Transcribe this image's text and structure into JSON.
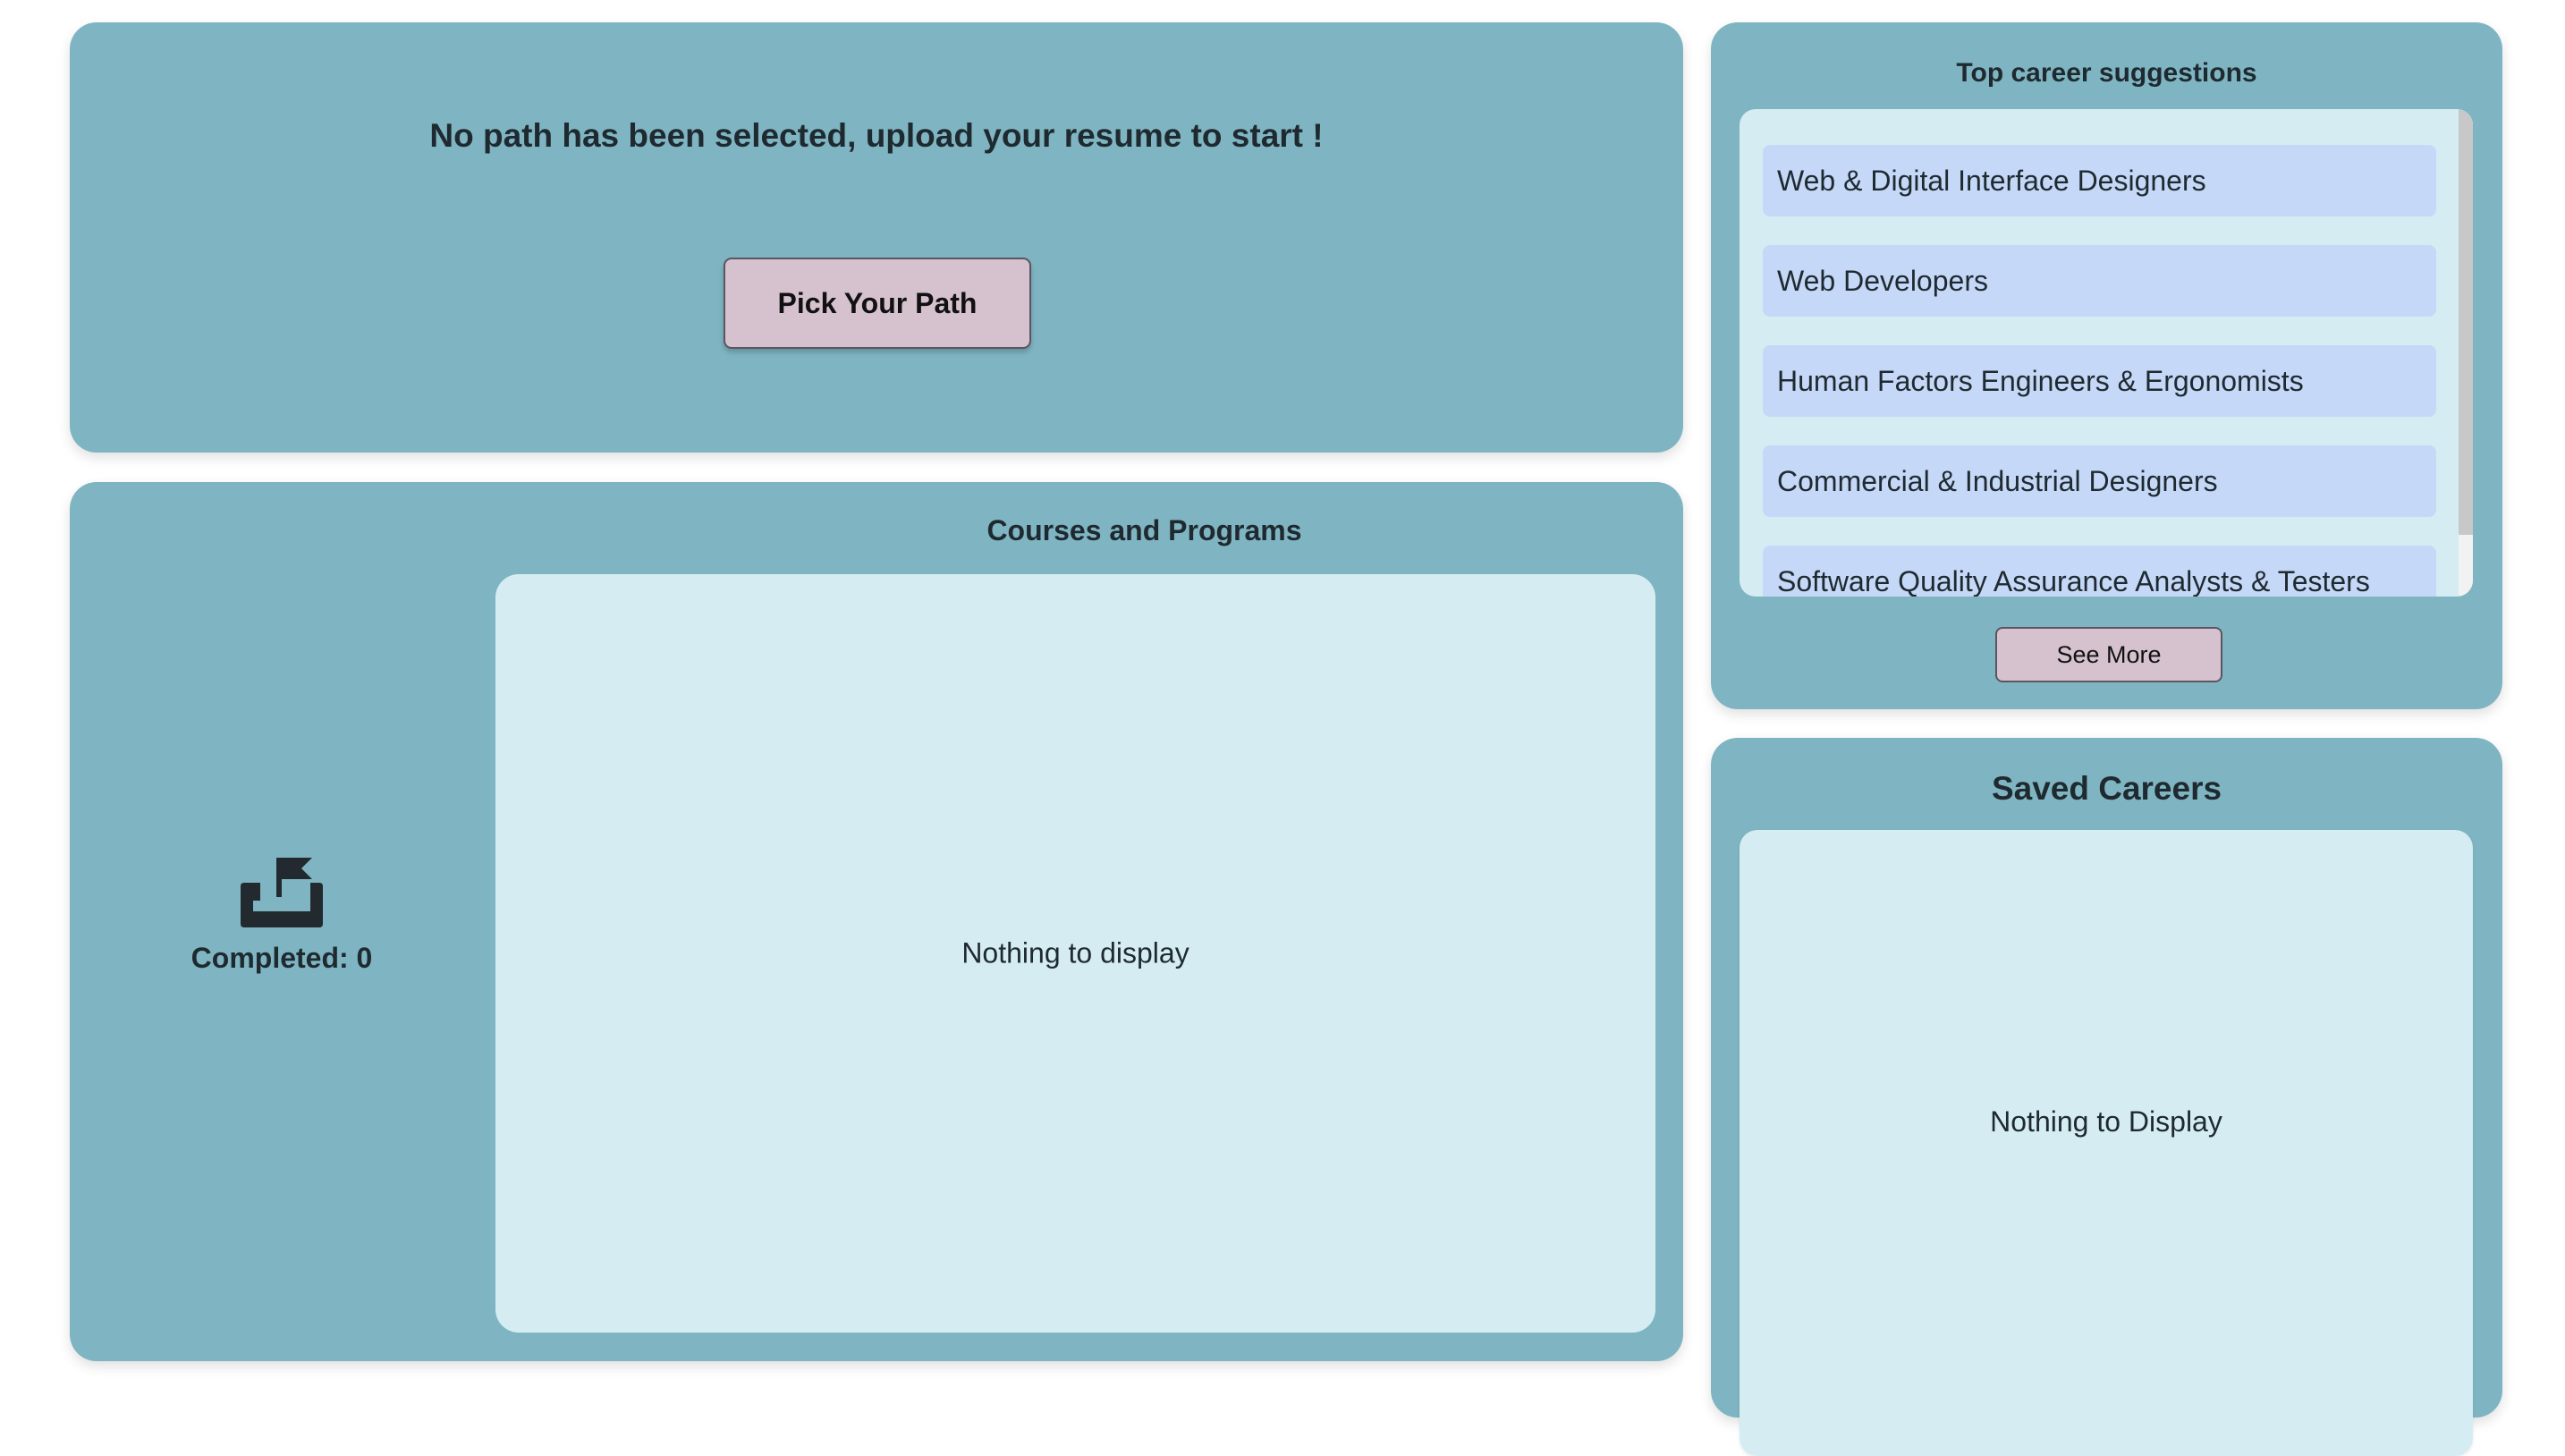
{
  "path_panel": {
    "message": "No path has been selected, upload your resume to start !",
    "button_label": "Pick Your Path"
  },
  "courses_panel": {
    "title": "Courses and Programs",
    "empty_text": "Nothing to display",
    "completed_label": "Completed: 0",
    "completed_icon": "flag-tray-icon"
  },
  "suggestions_panel": {
    "title": "Top career suggestions",
    "items": [
      {
        "label": "Web & Digital Interface Designers"
      },
      {
        "label": "Web Developers"
      },
      {
        "label": "Human Factors Engineers & Ergonomists"
      },
      {
        "label": "Commercial & Industrial Designers"
      },
      {
        "label": "Software Quality Assurance Analysts & Testers"
      }
    ],
    "see_more_label": "See More"
  },
  "saved_panel": {
    "title": "Saved Careers",
    "empty_text": "Nothing to Display"
  },
  "colors": {
    "panel": "#7fb5c2",
    "inner_box": "#d5edf2",
    "list_item": "#c5d8f7",
    "button": "#d6c2cf"
  }
}
